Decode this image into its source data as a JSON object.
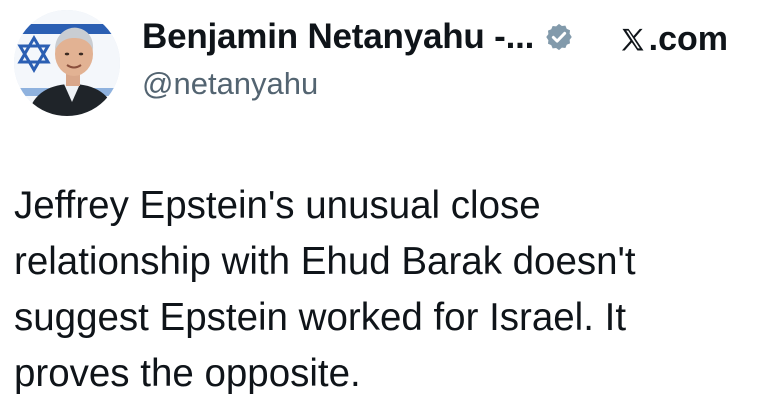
{
  "author": {
    "display_name": "Benjamin Netanyahu -...",
    "handle": "@netanyahu",
    "verified": true,
    "avatar": "profile-photo"
  },
  "source": {
    "logo": "x-logo",
    "label": ".com"
  },
  "tweet": {
    "lines": [
      "Jeffrey Epstein's unusual close",
      "relationship with Ehud Barak doesn't",
      "suggest Epstein worked for Israel. It",
      "proves the opposite."
    ]
  },
  "colors": {
    "text": "#0f1419",
    "secondary": "#536471",
    "verified_badge": "#829aab"
  }
}
